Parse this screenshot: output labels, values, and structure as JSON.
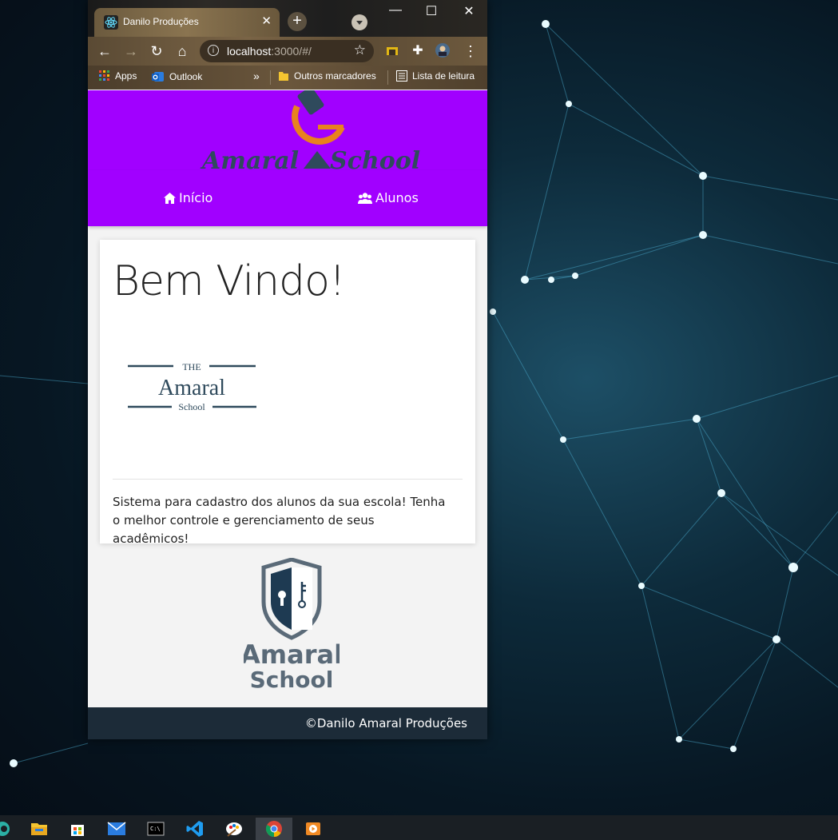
{
  "browser": {
    "tab_title": "Danilo Produções",
    "tab_close": "✕",
    "new_tab": "+",
    "window_controls": {
      "minimize": "—",
      "maximize": "☐",
      "close": "✕"
    },
    "url_host": "localhost",
    "url_path": ":3000/#/",
    "bookmarks": {
      "apps": "Apps",
      "outlook": "Outlook",
      "more": "»",
      "other": "Outros marcadores",
      "reading_list": "Lista de leitura"
    }
  },
  "page": {
    "brand_line1": "Amaral",
    "brand_line2": "School",
    "nav": [
      {
        "label": "Início",
        "icon": "home-icon"
      },
      {
        "label": "Alunos",
        "icon": "users-icon"
      }
    ],
    "card": {
      "title": "Bem Vindo!",
      "logo_the": "THE",
      "logo_name": "Amaral",
      "logo_school": "School",
      "text": "Sistema para cadastro dos alunos da sua escola! Tenha o melhor controle e gerenciamento de seus acadêmicos!"
    },
    "shield_logo_line1": "Amaral",
    "shield_logo_line2": "School",
    "footer": "©Danilo Amaral Produções"
  },
  "colors": {
    "header_purple": "#a100ff",
    "footer_dark": "#1c2b38",
    "logo_orange": "#e8821e",
    "logo_navy": "#2f4a5c"
  }
}
